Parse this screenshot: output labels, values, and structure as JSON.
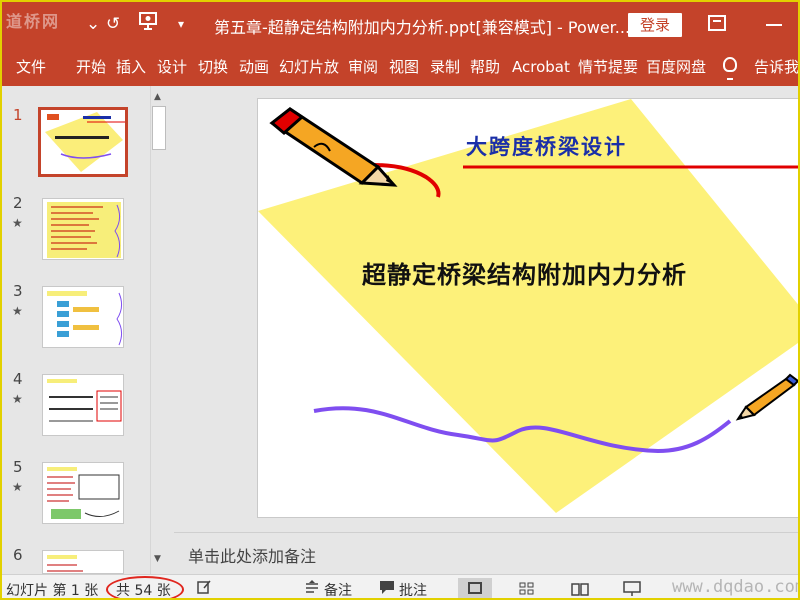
{
  "titlebar": {
    "watermark": "道桥网",
    "undo_glyph": "↺",
    "redo_glyph": "⌄",
    "more_glyph": "▾",
    "title": "第五章-超静定结构附加内力分析.ppt[兼容模式]  -  Power...",
    "login_label": "登录"
  },
  "ribbon": {
    "tabs": [
      "文件",
      "开始",
      "插入",
      "设计",
      "切换",
      "动画",
      "幻灯片放",
      "审阅",
      "视图",
      "录制",
      "帮助",
      "Acrobat",
      "情节提要",
      "百度网盘",
      "告诉我"
    ]
  },
  "thumbnails": {
    "items": [
      {
        "number": "1",
        "star": ""
      },
      {
        "number": "2",
        "star": "★"
      },
      {
        "number": "3",
        "star": "★"
      },
      {
        "number": "4",
        "star": "★"
      },
      {
        "number": "5",
        "star": "★"
      },
      {
        "number": "6",
        "star": ""
      }
    ],
    "scroll_up": "▲",
    "scroll_down": "▼"
  },
  "slide": {
    "subtitle": "大跨度桥梁设计",
    "title": "超静定桥梁结构附加内力分析"
  },
  "notes": {
    "placeholder": "单击此处添加备注"
  },
  "statusbar": {
    "slide_label": "幻灯片 第 1 张",
    "total_label": "共 54 张",
    "notes_label": "备注",
    "comments_label": "批注",
    "watermark": "www.dqdao.com"
  },
  "colors": {
    "ribbon": "#c4432a",
    "slide_yellow": "#fdf17a",
    "accent_blue": "#1a2fa8",
    "accent_red": "#e00000",
    "squiggle_purple": "#7f4ef0"
  }
}
